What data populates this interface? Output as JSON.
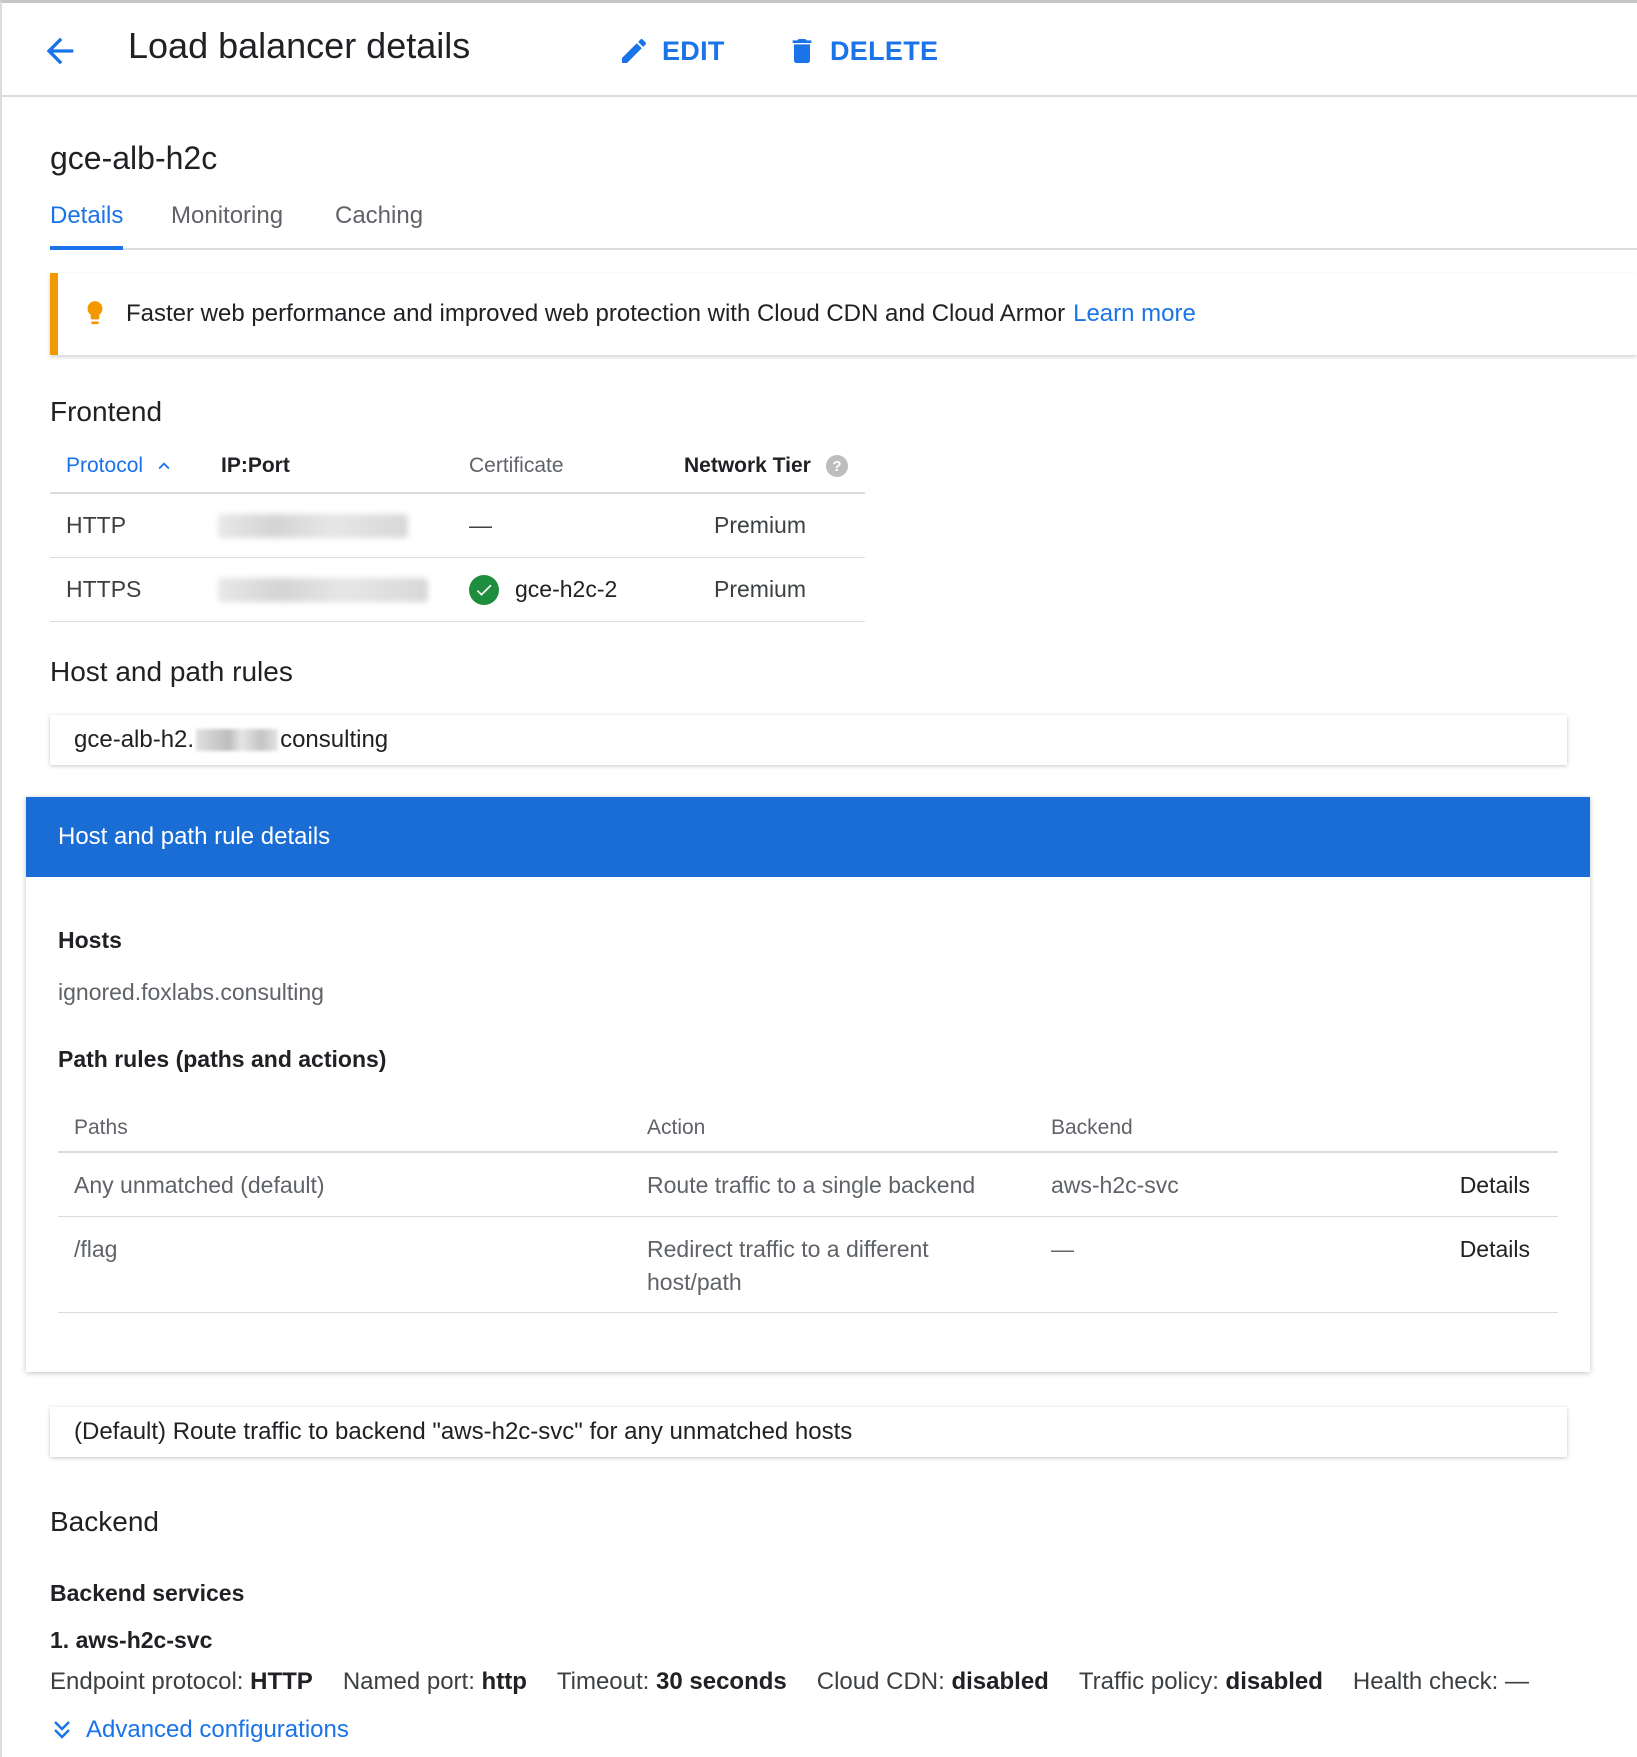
{
  "header": {
    "title": "Load balancer details",
    "edit_label": "EDIT",
    "delete_label": "DELETE"
  },
  "lb_name": "gce-alb-h2c",
  "tabs": [
    {
      "label": "Details",
      "active": true
    },
    {
      "label": "Monitoring",
      "active": false
    },
    {
      "label": "Caching",
      "active": false
    }
  ],
  "banner": {
    "text": "Faster web performance and improved web protection with Cloud CDN and Cloud Armor",
    "link": "Learn more"
  },
  "frontend": {
    "title": "Frontend",
    "columns": {
      "protocol": "Protocol",
      "ip_port": "IP:Port",
      "certificate": "Certificate",
      "network_tier": "Network Tier"
    },
    "rows": [
      {
        "protocol": "HTTP",
        "certificate": "—",
        "network_tier": "Premium"
      },
      {
        "protocol": "HTTPS",
        "certificate": "gce-h2c-2",
        "network_tier": "Premium"
      }
    ]
  },
  "host_path": {
    "title": "Host and path rules",
    "rule_prefix": "gce-alb-h2.",
    "rule_suffix": "consulting"
  },
  "rule_details": {
    "header": "Host and path rule details",
    "hosts_label": "Hosts",
    "hosts_value": "ignored.foxlabs.consulting",
    "path_rules_label": "Path rules (paths and actions)",
    "columns": {
      "paths": "Paths",
      "action": "Action",
      "backend": "Backend"
    },
    "rows": [
      {
        "path": "Any unmatched (default)",
        "action": "Route traffic to a single backend",
        "backend": "aws-h2c-svc",
        "link": "Details"
      },
      {
        "path": "/flag",
        "action": "Redirect traffic to a different host/path",
        "backend": "—",
        "link": "Details"
      }
    ]
  },
  "default_rule": "(Default) Route traffic to backend \"aws-h2c-svc\" for any unmatched hosts",
  "backend": {
    "title": "Backend",
    "services_label": "Backend services",
    "service_name": "1. aws-h2c-svc",
    "props": [
      {
        "label": "Endpoint protocol:",
        "value": "HTTP"
      },
      {
        "label": "Named port:",
        "value": "http"
      },
      {
        "label": "Timeout:",
        "value": "30 seconds"
      },
      {
        "label": "Cloud CDN:",
        "value": "disabled"
      },
      {
        "label": "Traffic policy:",
        "value": "disabled"
      },
      {
        "label": "Health check:",
        "value": "—"
      }
    ],
    "advanced_label": "Advanced configurations"
  },
  "icons": {
    "back": "arrow-back-icon",
    "edit": "pencil-icon",
    "delete": "trash-icon",
    "bulb": "lightbulb-icon",
    "sort": "chevron-up-icon",
    "help": "help-circle-icon",
    "check": "check-circle-icon",
    "expand": "double-chevron-down-icon"
  },
  "colors": {
    "accent": "#1a73e8",
    "header_bar": "#1a6dd4",
    "banner_accent": "#f29900",
    "success": "#1e8e3e"
  }
}
